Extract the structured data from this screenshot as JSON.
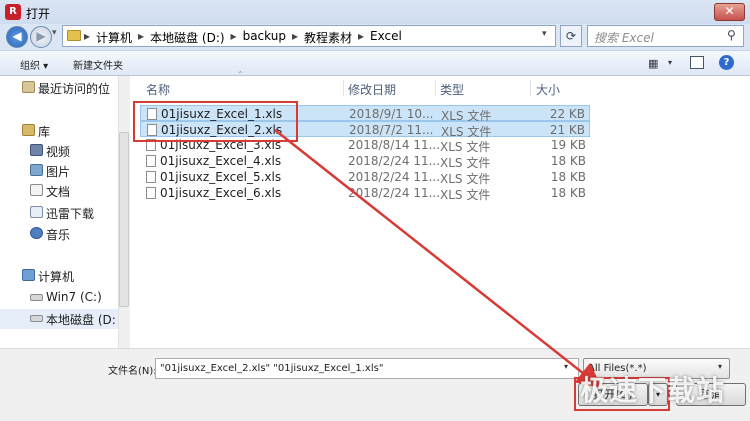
{
  "window": {
    "title": "打开",
    "app_icon_text": "R",
    "close_label": "✕"
  },
  "address": {
    "crumbs": [
      "计算机",
      "本地磁盘 (D:)",
      "backup",
      "教程素材",
      "Excel"
    ],
    "refresh_label": "⟳"
  },
  "search": {
    "placeholder": "搜索 Excel"
  },
  "toolbar": {
    "organize": "组织 ▾",
    "new_folder": "新建文件夹"
  },
  "sidebar": {
    "items": [
      {
        "label": "最近访问的位",
        "icon": "recent-icon"
      },
      {
        "label": "库",
        "icon": "library-icon"
      },
      {
        "label": "视频",
        "icon": "video-icon"
      },
      {
        "label": "图片",
        "icon": "picture-icon"
      },
      {
        "label": "文档",
        "icon": "document-icon"
      },
      {
        "label": "迅雷下载",
        "icon": "thunder-icon"
      },
      {
        "label": "音乐",
        "icon": "music-icon"
      },
      {
        "label": "计算机",
        "icon": "computer-icon"
      },
      {
        "label": "Win7 (C:)",
        "icon": "drive-icon"
      },
      {
        "label": "本地磁盘 (D:",
        "icon": "drive-icon"
      }
    ]
  },
  "columns": {
    "name": "名称",
    "date": "修改日期",
    "type": "类型",
    "size": "大小"
  },
  "files": [
    {
      "name": "01jisuxz_Excel_1.xls",
      "date": "2018/9/1 10...",
      "type": "XLS 文件",
      "size": "22 KB",
      "selected": true
    },
    {
      "name": "01jisuxz_Excel_2.xls",
      "date": "2018/7/2 11...",
      "type": "XLS 文件",
      "size": "21 KB",
      "selected": true
    },
    {
      "name": "01jisuxz_Excel_3.xls",
      "date": "2018/8/14 11...",
      "type": "XLS 文件",
      "size": "19 KB",
      "selected": false
    },
    {
      "name": "01jisuxz_Excel_4.xls",
      "date": "2018/2/24 11...",
      "type": "XLS 文件",
      "size": "18 KB",
      "selected": false
    },
    {
      "name": "01jisuxz_Excel_5.xls",
      "date": "2018/2/24 11...",
      "type": "XLS 文件",
      "size": "18 KB",
      "selected": false
    },
    {
      "name": "01jisuxz_Excel_6.xls",
      "date": "2018/2/24 11...",
      "type": "XLS 文件",
      "size": "18 KB",
      "selected": false
    }
  ],
  "bottom": {
    "filename_label": "文件名(N):",
    "filename_value": "\"01jisuxz_Excel_2.xls\" \"01jisuxz_Excel_1.xls\"",
    "filter_value": "All Files(*.*)",
    "open_label": "打开(O)",
    "cancel_label": "取消"
  },
  "watermark": "极速下载站",
  "colors": {
    "annotation": "#d83b35",
    "selection": "#cce4f7"
  }
}
